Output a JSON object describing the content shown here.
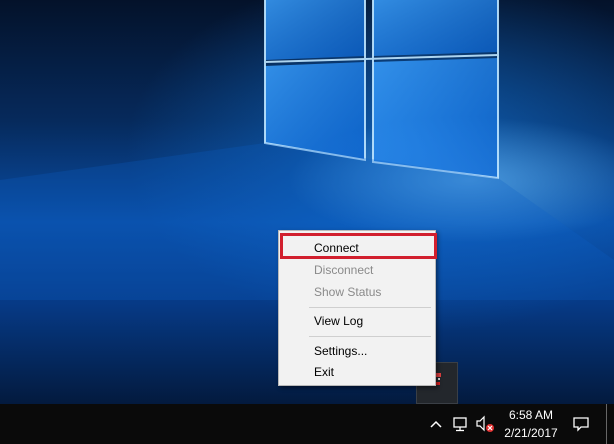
{
  "context_menu": {
    "items": [
      {
        "label": "Connect",
        "enabled": true
      },
      {
        "label": "Disconnect",
        "enabled": false
      },
      {
        "label": "Show Status",
        "enabled": false
      },
      {
        "label": "View Log",
        "enabled": true
      },
      {
        "label": "Settings...",
        "enabled": true
      },
      {
        "label": "Exit",
        "enabled": true
      }
    ],
    "highlighted_item": "Connect",
    "highlight_color": "#d11f2e"
  },
  "taskbar": {
    "time": "6:58 AM",
    "date": "2/21/2017",
    "tray_icons": [
      "chevron-up-icon",
      "network-icon",
      "speaker-muted-icon",
      "action-center-icon"
    ]
  },
  "colors": {
    "desktop_blue": "#0a4ea6",
    "taskbar": "#0a0a0a",
    "menu_bg": "#f2f2f2",
    "disabled_text": "#8a8a8a"
  }
}
